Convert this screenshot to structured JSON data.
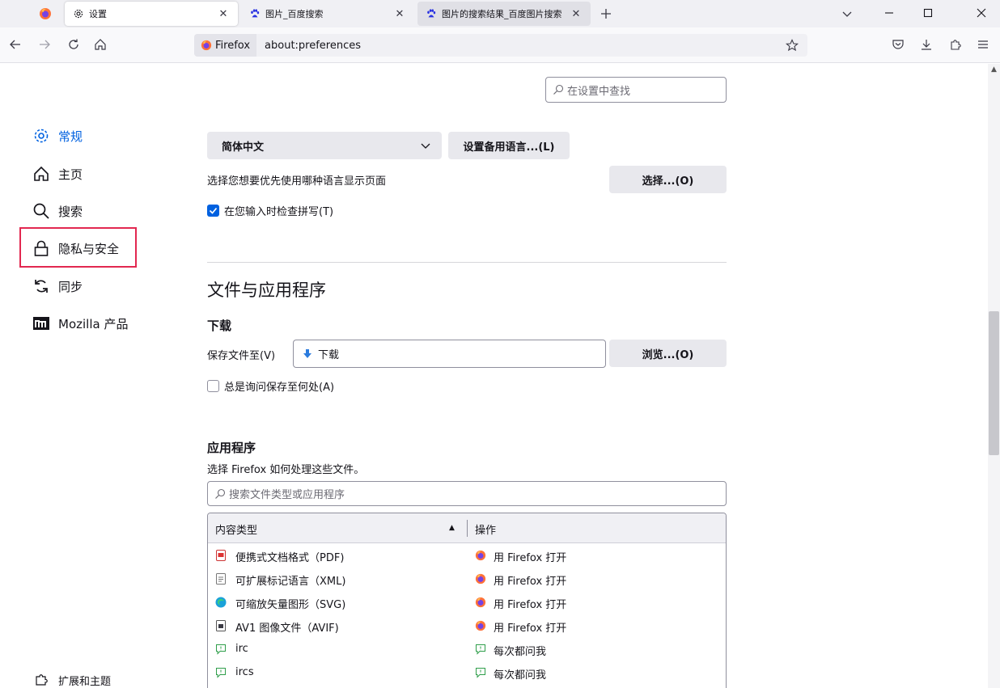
{
  "tabs": [
    {
      "title": "设置",
      "icon": "gear-icon"
    },
    {
      "title": "图片_百度搜索",
      "icon": "baidu-icon"
    },
    {
      "title": "图片的搜索结果_百度图片搜索",
      "icon": "baidu-icon"
    }
  ],
  "nav": {
    "identity_label": "Firefox",
    "url": "about:preferences"
  },
  "sidebar": {
    "categories": [
      {
        "label": "常规",
        "icon": "gear-icon",
        "selected": true
      },
      {
        "label": "主页",
        "icon": "home-icon"
      },
      {
        "label": "搜索",
        "icon": "search-icon"
      },
      {
        "label": "隐私与安全",
        "icon": "lock-icon"
      },
      {
        "label": "同步",
        "icon": "sync-icon"
      },
      {
        "label": "Mozilla 产品",
        "icon": "mozilla-icon"
      }
    ],
    "extensions_label": "扩展和主题"
  },
  "main": {
    "search_placeholder": "在设置中查找",
    "language": {
      "selected": "简体中文",
      "alt_button": "设置备用语言...(L)",
      "desc": "选择您想要优先使用哪种语言显示页面",
      "choose_button": "选择...(O)",
      "spellcheck_label": "在您输入时检查拼写(T)",
      "spellcheck_checked": true
    },
    "files_heading": "文件与应用程序",
    "downloads": {
      "heading": "下载",
      "save_label": "保存文件至(V)",
      "save_folder": "下载",
      "browse_button": "浏览...(O)",
      "always_ask_label": "总是询问保存至何处(A)",
      "always_ask_checked": false
    },
    "applications": {
      "heading": "应用程序",
      "desc": "选择 Firefox 如何处理这些文件。",
      "search_placeholder": "搜索文件类型或应用程序",
      "col_type": "内容类型",
      "col_action": "操作",
      "rows": [
        {
          "type": "便携式文档格式（PDF)",
          "type_icon": "pdf-icon",
          "action": "用 Firefox 打开",
          "action_icon": "firefox-icon"
        },
        {
          "type": "可扩展标记语言（XML)",
          "type_icon": "xml-file-icon",
          "action": "用 Firefox 打开",
          "action_icon": "firefox-icon"
        },
        {
          "type": "可缩放矢量图形（SVG)",
          "type_icon": "edge-icon",
          "action": "用 Firefox 打开",
          "action_icon": "firefox-icon"
        },
        {
          "type": "AV1 图像文件（AVIF)",
          "type_icon": "image-file-icon",
          "action": "用 Firefox 打开",
          "action_icon": "firefox-icon"
        },
        {
          "type": "irc",
          "type_icon": "chat-icon",
          "action": "每次都问我",
          "action_icon": "chat-icon"
        },
        {
          "type": "ircs",
          "type_icon": "chat-icon",
          "action": "每次都问我",
          "action_icon": "chat-icon"
        }
      ]
    }
  }
}
